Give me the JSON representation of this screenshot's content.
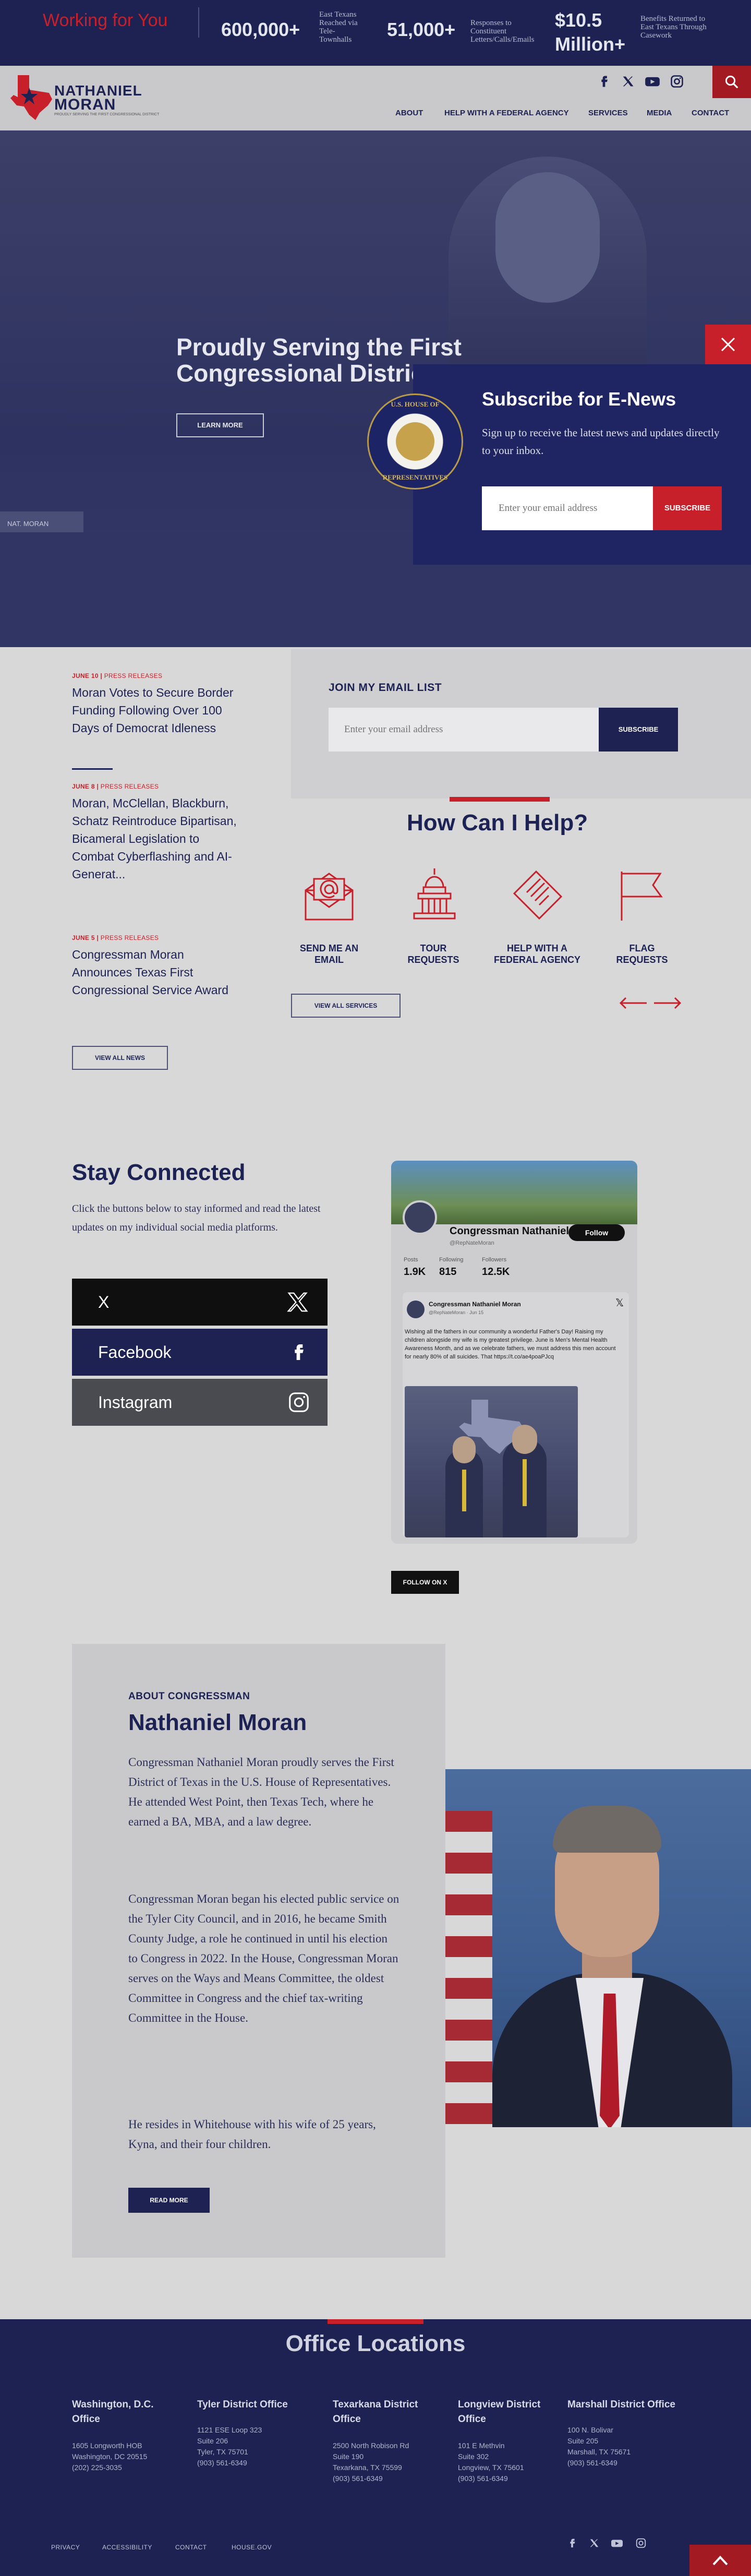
{
  "topbar": {
    "tagline": "Working for You",
    "stats": [
      {
        "number": "600,000+",
        "label": "East Texans Reached via Tele-Townhalls"
      },
      {
        "number": "51,000+",
        "label": "Responses to Constituent Letters/Calls/Emails"
      },
      {
        "number": "$10.5 Million+",
        "label": "Benefits Returned to East Texans Through Casework"
      }
    ]
  },
  "header": {
    "logo_line1": "NATHANIEL",
    "logo_line2": "MORAN",
    "logo_tagline": "PROUDLY SERVING THE FIRST CONGRESSIONAL DISTRICT",
    "nav": [
      "ABOUT",
      "HELP WITH A FEDERAL AGENCY",
      "SERVICES",
      "MEDIA",
      "CONTACT"
    ],
    "social_icons": [
      "facebook-icon",
      "x-icon",
      "youtube-icon",
      "instagram-icon"
    ]
  },
  "hero": {
    "title": "Proudly Serving the First Congressional District",
    "learn_more": "LEARN MORE",
    "placard_left": "NAT. MORAN"
  },
  "modal": {
    "title": "Subscribe for E-News",
    "description": "Sign up to receive the latest news and updates directly to your inbox.",
    "email_placeholder": "Enter your email address",
    "subscribe": "SUBSCRIBE",
    "seal_top": "U.S. HOUSE OF",
    "seal_bottom": "REPRESENTATIVES"
  },
  "news": {
    "items": [
      {
        "date": "JUNE 10",
        "category": "PRESS RELEASES",
        "title": "Moran Votes to Secure Border Funding Following Over 100 Days of Democrat Idleness"
      },
      {
        "date": "JUNE 8",
        "category": "PRESS RELEASES",
        "title": "Moran, McClellan, Blackburn, Schatz Reintroduce Bipartisan, Bicameral Legislation to Combat Cyberflashing and AI-Generat..."
      },
      {
        "date": "JUNE 5",
        "category": "PRESS RELEASES",
        "title": "Congressman Moran Announces Texas First Congressional Service Award"
      }
    ],
    "view_all": "VIEW ALL NEWS"
  },
  "email_list": {
    "title": "JOIN MY EMAIL LIST",
    "placeholder": "Enter your email address",
    "subscribe": "SUBSCRIBE"
  },
  "help": {
    "title": "How Can I Help?",
    "services": [
      {
        "label": "SEND ME AN EMAIL",
        "icon": "email-icon"
      },
      {
        "label": "TOUR REQUESTS",
        "icon": "capitol-icon"
      },
      {
        "label": "HELP WITH A FEDERAL AGENCY",
        "icon": "document-icon"
      },
      {
        "label": "FLAG REQUESTS",
        "icon": "flag-icon"
      }
    ],
    "view_all": "VIEW ALL SERVICES"
  },
  "stay_connected": {
    "title": "Stay Connected",
    "description": "Click the buttons below to stay informed and read the latest updates on my individual social media platforms.",
    "buttons": [
      {
        "label": "X",
        "color": "#0f0f10"
      },
      {
        "label": "Facebook",
        "color": "#1e2252"
      },
      {
        "label": "Instagram",
        "color": "#4a4b50"
      }
    ]
  },
  "twitter": {
    "name": "Congressman Nathaniel...",
    "handle": "@RepNateMoran",
    "follow": "Follow",
    "stats": [
      {
        "label": "Posts",
        "value": "1.9K"
      },
      {
        "label": "Following",
        "value": "815"
      },
      {
        "label": "Followers",
        "value": "12.5K"
      }
    ],
    "post_name": "Congressman Nathaniel Moran",
    "post_handle": "@RepNateMoran · Jun 15",
    "post_text": "Wishing all the fathers in our community a wonderful Father's Day! Raising my children alongside my wife is my greatest privilege. June is Men's Mental Health Awareness Month, and as we celebrate fathers, we must address this men account for nearly 80% of all suicides. That https://t.co/ae4poaPJcq",
    "follow_on_x": "FOLLOW ON X"
  },
  "about": {
    "kicker": "ABOUT CONGRESSMAN",
    "name": "Nathaniel Moran",
    "paragraphs": [
      "Congressman Nathaniel Moran proudly serves the First District of Texas in the U.S. House of Representatives. He attended West Point, then Texas Tech, where he earned a BA, MBA, and a law degree.",
      "Congressman Moran began his elected public service on the Tyler City Council, and in 2016, he became Smith County Judge, a role he continued in until his election to Congress in 2022. In the House, Congressman Moran serves on the Ways and Means Committee, the oldest Committee in Congress and the chief tax-writing Committee in the House.",
      "He resides in Whitehouse with his wife of 25 years, Kyna, and their four children."
    ],
    "read_more": "READ MORE"
  },
  "offices": {
    "title": "Office Locations",
    "list": [
      {
        "name": "Washington, D.C. Office",
        "address": [
          "1605 Longworth HOB",
          "Washington, DC 20515",
          "(202) 225-3035"
        ]
      },
      {
        "name": "Tyler District Office",
        "address": [
          "1121 ESE Loop 323",
          "Suite 206",
          "Tyler, TX 75701",
          "(903) 561-6349"
        ]
      },
      {
        "name": "Texarkana District Office",
        "address": [
          "2500 North Robison Rd",
          "Suite 190",
          "Texarkana, TX 75599",
          "(903) 561-6349"
        ]
      },
      {
        "name": "Longview District Office",
        "address": [
          "101 E Methvin",
          "Suite 302",
          "Longview, TX 75601",
          "(903) 561-6349"
        ]
      },
      {
        "name": "Marshall District Office",
        "address": [
          "100 N. Bolivar",
          "Suite 205",
          "Marshall, TX 75671",
          "(903) 561-6349"
        ]
      }
    ]
  },
  "footer": {
    "links": [
      "PRIVACY",
      "ACCESSIBILITY",
      "CONTACT",
      "HOUSE.GOV"
    ]
  },
  "colors": {
    "navy": "#1e2252",
    "red": "#c8202a"
  }
}
